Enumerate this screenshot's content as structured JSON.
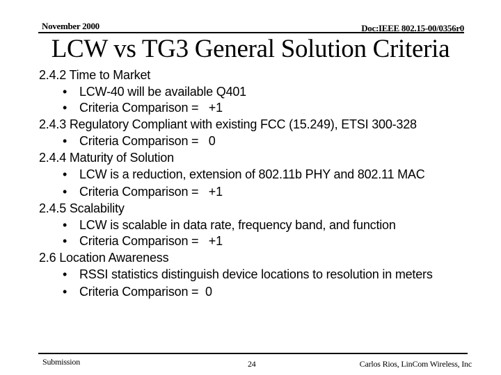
{
  "header": {
    "date": "November  2000",
    "doc_id": "Doc:IEEE 802.15-00/0356r0"
  },
  "title": "LCW vs TG3 General Solution Criteria",
  "sections": [
    {
      "heading": "2.4.2 Time to Market",
      "bullets": [
        "LCW-40 will be available Q401",
        "Criteria Comparison =   +1"
      ]
    },
    {
      "heading": "2.4.3 Regulatory Compliant with existing FCC (15.249), ETSI 300-328",
      "bullets": [
        "Criteria Comparison =   0"
      ]
    },
    {
      "heading": "2.4.4 Maturity of Solution",
      "bullets": [
        "LCW is a reduction, extension of 802.11b PHY and 802.11 MAC",
        "Criteria Comparison =   +1"
      ]
    },
    {
      "heading": "2.4.5 Scalability",
      "bullets": [
        "LCW is scalable in data rate, frequency band, and function",
        "Criteria Comparison =   +1"
      ]
    },
    {
      "heading": "2.6 Location Awareness",
      "bullets": [
        "RSSI statistics distinguish device locations to resolution in meters",
        "Criteria Comparison =  0"
      ]
    }
  ],
  "bullet_glyph": "•",
  "footer": {
    "left": "Submission",
    "page": "24",
    "right": "Carlos Rios, LinCom Wireless, Inc"
  }
}
